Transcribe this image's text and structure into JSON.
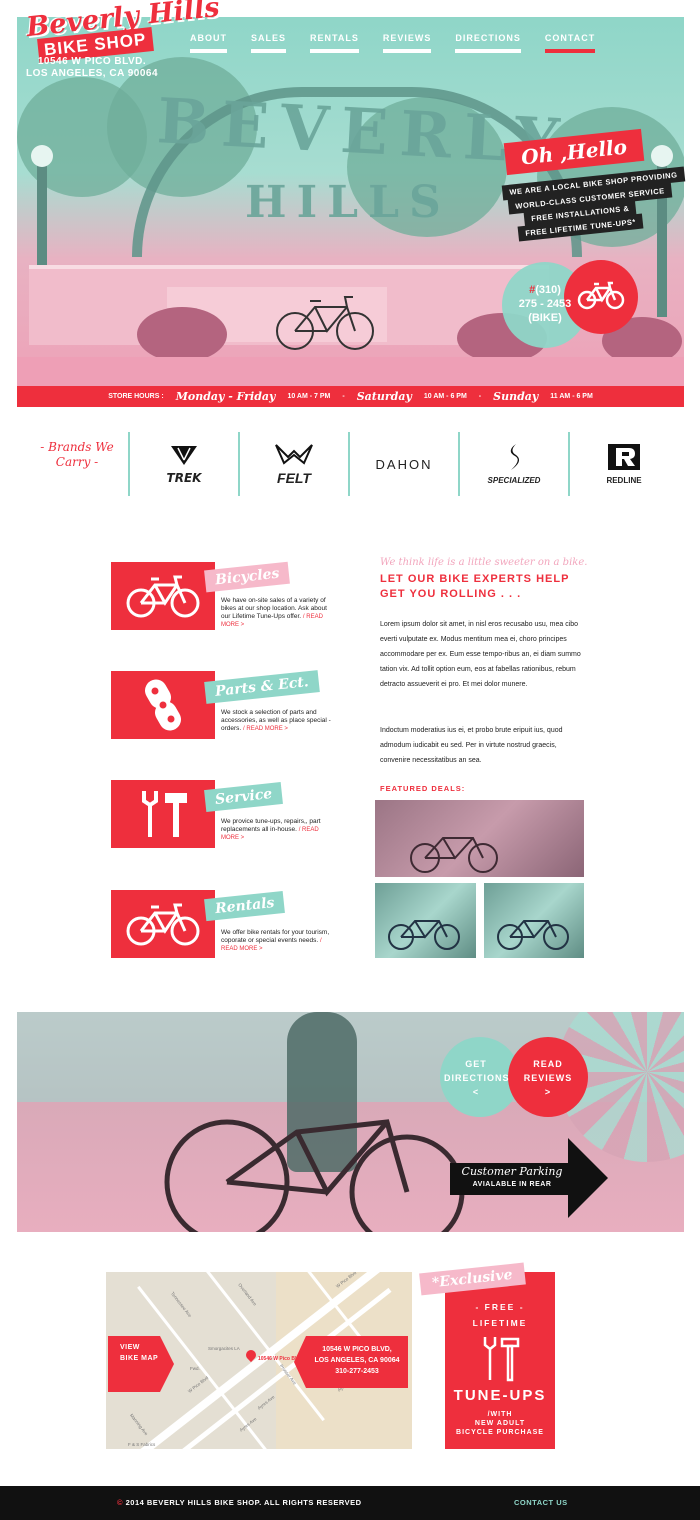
{
  "logo": {
    "line1": "Beverly Hills",
    "line2": "BIKE SHOP"
  },
  "address": {
    "line1": "10546 W PICO BLVD.",
    "line2": "LOS ANGELES, CA 90064"
  },
  "nav": [
    {
      "label": "ABOUT"
    },
    {
      "label": "SALES"
    },
    {
      "label": "RENTALS"
    },
    {
      "label": "REVIEWS"
    },
    {
      "label": "DIRECTIONS"
    },
    {
      "label": "CONTACT",
      "active": true
    }
  ],
  "hero": {
    "sign_top": "BEVERLY",
    "sign_bottom": "HILLS",
    "greeting": "Oh ,Hello",
    "tagline": [
      "WE ARE A LOCAL BIKE SHOP PROVIDING",
      "WORLD-CLASS CUSTOMER SERVICE",
      "FREE INSTALLATIONS &",
      "FREE LIFETIME TUNE-UPS*"
    ],
    "phone": {
      "prefix": "#",
      "area": "(310)",
      "number": "275 - 2453",
      "word": "(BIKE)"
    }
  },
  "hours": {
    "label": "STORE HOURS :",
    "weekday_days": "Monday - Friday",
    "weekday_time": "10 AM - 7 PM",
    "sep": "-",
    "sat_day": "Saturday",
    "sat_time": "10 AM - 6 PM",
    "sun_day": "Sunday",
    "sun_time": "11 AM - 6 PM"
  },
  "brands": {
    "label": "- Brands We Carry -",
    "items": [
      "TREK",
      "FELT",
      "DAHON",
      "SPECIALIZED",
      "REDLINE"
    ]
  },
  "services": [
    {
      "title": "Bicycles",
      "text": "We have on-site sales of a variety of bikes at our shop location. Ask about our Lifetime Tune-Ups offer.",
      "link": "/ READ MORE >",
      "icon": "bicycle-icon",
      "label_color": "#f6b9ca"
    },
    {
      "title": "Parts & Ect.",
      "text": "We stock a selection of parts and accessories, as well as place special -orders.",
      "link": "/ READ MORE >",
      "icon": "chain-link-icon",
      "label_color": "#8fd6c8"
    },
    {
      "title": "Service",
      "text": "We provice tune-ups, repairs,, part replacements all in-house.",
      "link": "/ READ MORE >",
      "icon": "wrench-hammer-icon",
      "label_color": "#8fd6c8"
    },
    {
      "title": "Rentals",
      "text": "We offer bike rentals for your tourism, coporate or special events needs.",
      "link": "/ READ MORE >",
      "icon": "bicycle-icon",
      "label_color": "#8fd6c8"
    }
  ],
  "about": {
    "tagline": "We think life is a little sweeter on a bike.",
    "headline": "LET OUR BIKE EXPERTS HELP GET YOU ROLLING . . .",
    "para1": "Lorem ipsum dolor sit amet, in nisl eros recusabo usu, mea cibo everti vulputate ex. Modus mentitum mea ei, choro principes accommodare per ex. Eum esse tempo-ribus an, ei diam summo tation vix. Ad tollit option eum, eos at fabellas rationibus, rebum detracto assueverit ei pro. Et mei dolor munere.",
    "para2": "Indoctum moderatius ius ei, et probo brute eripuit ius, quod admodum iudicabit eu sed. Per in virtute nostrud graecis, convenire necessitatibus an sea.",
    "featured_label": "FEATURED DEALS:"
  },
  "promo": {
    "directions": "GET DIRECTIONS",
    "directions_arrow": "<",
    "reviews": "READ REVIEWS",
    "reviews_arrow": ">",
    "parking_title": "Customer Parking",
    "parking_sub": "AVIALABLE IN REAR"
  },
  "map": {
    "button": "VIEW BIKE MAP",
    "pin_label": "10546 W Pico Blvd",
    "address": [
      "10546 W PICO BLVD,",
      "LOS ANGELES, CA 90064",
      "310-277-2453"
    ],
    "streets": [
      "W Pico Blvd",
      "W Pico Blvd",
      "Ayres Ave",
      "Ayres Ave",
      "Ayres Ave",
      "Prosser Ave",
      "Overland Ave",
      "Manning Ave",
      "Tennessee Ave",
      "Fwd.",
      "Smorgacites LA",
      "F & S Fabrics"
    ]
  },
  "exclusive": {
    "tag": "*Exclusive",
    "line1": "- FREE -",
    "line2": "LIFETIME",
    "big": "TUNE-UPS",
    "line3": "/WITH",
    "line4": "NEW ADULT",
    "line5": "BICYCLE PURCHASE"
  },
  "footer": {
    "copyright_symbol": "©",
    "copyright": "2014 BEVERLY HILLS BIKE SHOP. ALL RIGHTS RESERVED",
    "contact": "CONTACT US"
  },
  "colors": {
    "red": "#ee2f3d",
    "mint": "#8fd6c8",
    "pink": "#f6b9ca",
    "black": "#111111"
  }
}
